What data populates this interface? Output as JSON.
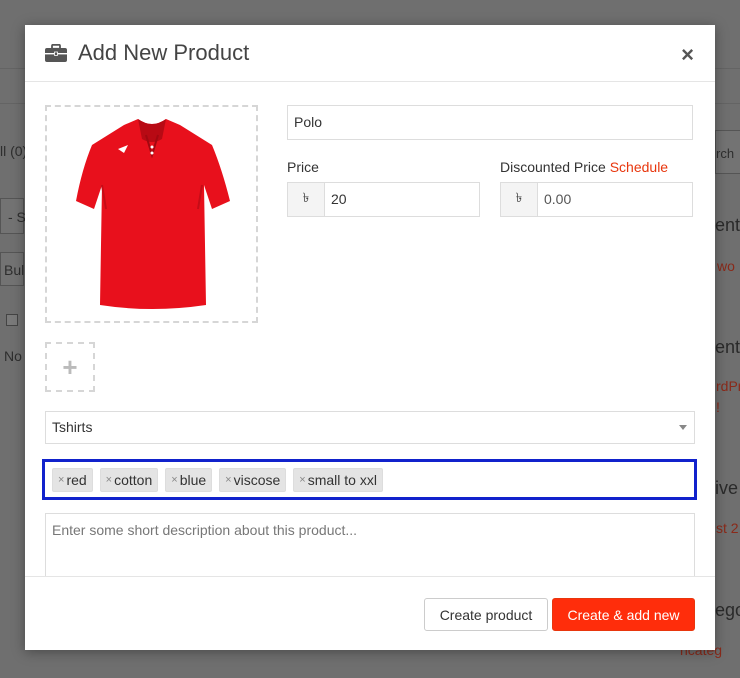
{
  "background": {
    "left_fragments": [
      "ll (0)",
      "- S",
      "Bul",
      "No"
    ],
    "right_fragments": [
      {
        "text": "rch",
        "style": "normal"
      },
      {
        "text": "ent",
        "style": "big"
      },
      {
        "text": "wo",
        "style": "red"
      },
      {
        "text": "ent",
        "style": "big"
      },
      {
        "text": "rdPr",
        "style": "red"
      },
      {
        "text": "!",
        "style": "red"
      },
      {
        "text": "ive",
        "style": "big"
      },
      {
        "text": "st 2",
        "style": "red"
      },
      {
        "text": "ego",
        "style": "big"
      },
      {
        "text": "ncateg",
        "style": "red"
      }
    ]
  },
  "modal": {
    "title": "Add New Product",
    "header_icon": "briefcase-icon",
    "close_label": "×",
    "product_title_value": "Polo",
    "price": {
      "label": "Price",
      "currency_symbol": "৳",
      "value": "20"
    },
    "discounted_price": {
      "label": "Discounted Price",
      "schedule_link": "Schedule",
      "currency_symbol": "৳",
      "placeholder": "0.00"
    },
    "image": {
      "product": "red polo t-shirt",
      "shirt_color": "#e8101c",
      "add_image_label": "+"
    },
    "category": {
      "selected": "Tshirts"
    },
    "tags": [
      {
        "label": "red"
      },
      {
        "label": "cotton"
      },
      {
        "label": "blue"
      },
      {
        "label": "viscose"
      },
      {
        "label": "small to xxl"
      }
    ],
    "tag_remove_symbol": "×",
    "description_placeholder": "Enter some short description about this product...",
    "buttons": {
      "create": "Create product",
      "create_and_add": "Create & add new"
    },
    "colors": {
      "accent": "#ff2d0b",
      "focus_border": "#1122cc"
    }
  }
}
